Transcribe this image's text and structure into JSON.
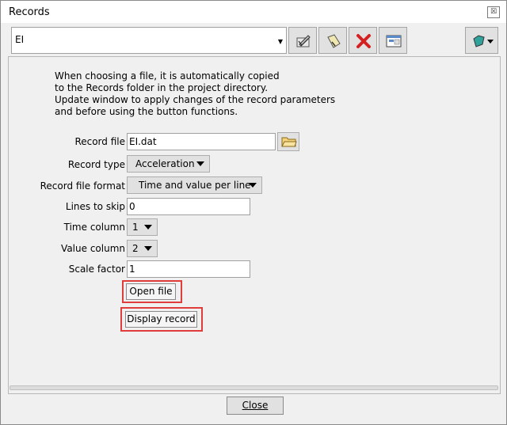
{
  "window": {
    "title": "Records"
  },
  "toolbar": {
    "record_select": "EI",
    "icons": [
      "edit-icon",
      "rename-icon",
      "delete-icon",
      "window-icon",
      "options-icon"
    ]
  },
  "info": {
    "lines": [
      "When choosing a file, it is automatically copied",
      "to the Records folder in the project directory.",
      "Update window to apply changes of the record parameters",
      "and before using the button functions."
    ]
  },
  "form": {
    "record_file_label": "Record file",
    "record_file_value": "EI.dat",
    "record_type_label": "Record type",
    "record_type_value": "Acceleration",
    "record_format_label": "Record file format",
    "record_format_value": "Time and value per line",
    "lines_to_skip_label": "Lines to skip",
    "lines_to_skip_value": "0",
    "time_column_label": "Time column",
    "time_column_value": "1",
    "value_column_label": "Value column",
    "value_column_value": "2",
    "scale_factor_label": "Scale factor",
    "scale_factor_value": "1"
  },
  "buttons": {
    "open_file": "Open file",
    "display_record": "Display record",
    "close": "Close"
  },
  "colors": {
    "highlight": "#e03c3c",
    "delete": "#d42020"
  }
}
